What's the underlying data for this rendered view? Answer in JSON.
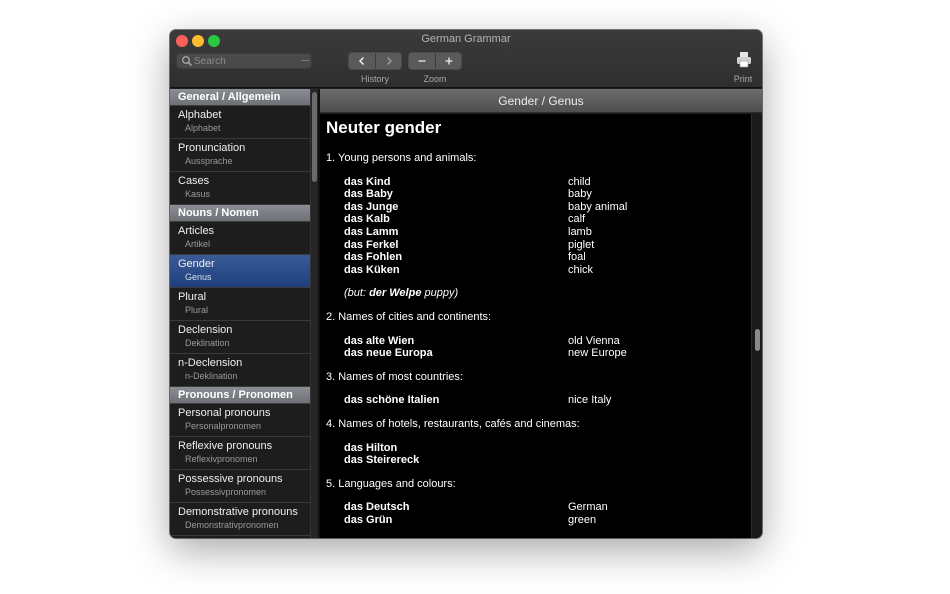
{
  "window": {
    "title": "German Grammar"
  },
  "toolbar": {
    "search_placeholder": "Search",
    "history_label": "History",
    "zoom_label": "Zoom",
    "print_label": "Print",
    "icons": [
      "search-icon",
      "back-icon",
      "forward-icon",
      "zoom-out-icon",
      "zoom-in-icon",
      "printer-icon"
    ]
  },
  "sidebar": {
    "sections": [
      {
        "header": "General / Allgemein",
        "items": [
          {
            "title": "Alphabet",
            "subtitle": "Alphabet"
          },
          {
            "title": "Pronunciation",
            "subtitle": "Aussprache"
          },
          {
            "title": "Cases",
            "subtitle": "Kasus"
          }
        ]
      },
      {
        "header": "Nouns / Nomen",
        "items": [
          {
            "title": "Articles",
            "subtitle": "Artikel"
          },
          {
            "title": "Gender",
            "subtitle": "Genus",
            "selected": true
          },
          {
            "title": "Plural",
            "subtitle": "Plural"
          },
          {
            "title": "Declension",
            "subtitle": "Deklination"
          },
          {
            "title": "n-Declension",
            "subtitle": "n-Deklination"
          }
        ]
      },
      {
        "header": "Pronouns / Pronomen",
        "items": [
          {
            "title": "Personal pronouns",
            "subtitle": "Personalpronomen"
          },
          {
            "title": "Reflexive pronouns",
            "subtitle": "Reflexivpronomen"
          },
          {
            "title": "Possessive pronouns",
            "subtitle": "Possessivpronomen"
          },
          {
            "title": "Demonstrative pronouns",
            "subtitle": "Demonstrativpronomen"
          }
        ]
      }
    ]
  },
  "content": {
    "header": "Gender / Genus",
    "title": "Neuter gender",
    "points": [
      {
        "text": "1. Young persons and animals:",
        "examples": [
          [
            "das Kind",
            "child"
          ],
          [
            "das Baby",
            "baby"
          ],
          [
            "das Junge",
            "baby animal"
          ],
          [
            "das Kalb",
            "calf"
          ],
          [
            "das Lamm",
            "lamb"
          ],
          [
            "das Ferkel",
            "piglet"
          ],
          [
            "das Fohlen",
            "foal"
          ],
          [
            "das Küken",
            "chick"
          ]
        ],
        "note": {
          "open": "(but: ",
          "bold": "der Welpe",
          "close": " puppy)"
        }
      },
      {
        "text": "2. Names of cities and continents:",
        "examples": [
          [
            "das alte Wien",
            "old Vienna"
          ],
          [
            "das neue Europa",
            "new Europe"
          ]
        ]
      },
      {
        "text": "3. Names of most countries:",
        "examples": [
          [
            "das schöne Italien",
            "nice Italy"
          ]
        ]
      },
      {
        "text": "4. Names of hotels, restaurants, cafés and cinemas:",
        "examples": [
          [
            "das Hilton",
            ""
          ],
          [
            "das Steirereck",
            ""
          ]
        ]
      },
      {
        "text": "5. Languages and colours:",
        "examples": [
          [
            "das Deutsch",
            "German"
          ],
          [
            "das Grün",
            "green"
          ]
        ]
      }
    ]
  }
}
